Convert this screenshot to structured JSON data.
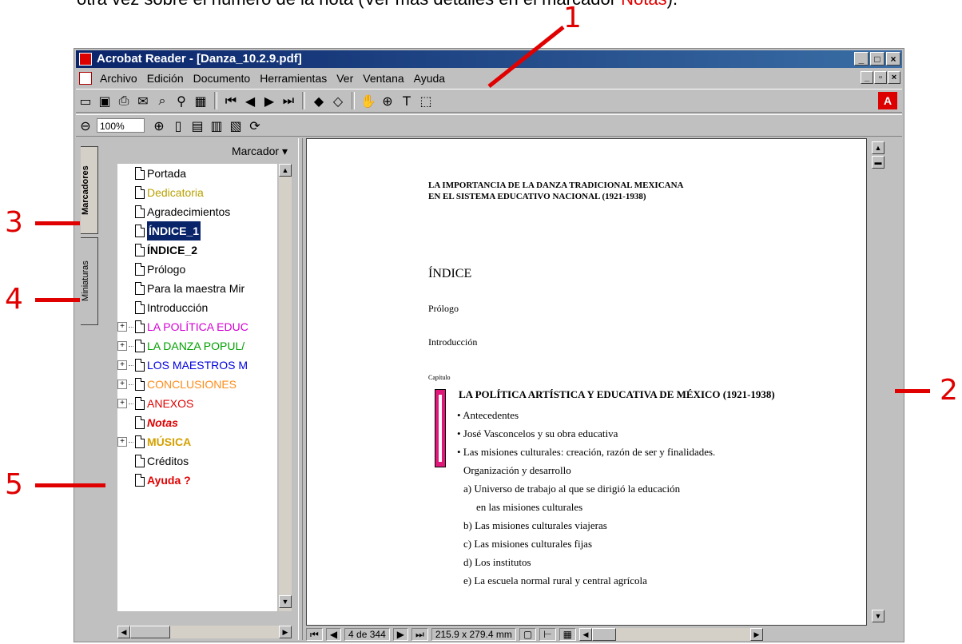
{
  "caption": {
    "text": "otra vez sobre el número de la nota (Ver más detalles en el marcador",
    "highlight": "Notas",
    "tail": ")."
  },
  "callouts": [
    "1",
    "2",
    "3",
    "4",
    "5"
  ],
  "window": {
    "title": "Acrobat Reader - [Danza_10.2.9.pdf]",
    "menu": [
      "Archivo",
      "Edición",
      "Documento",
      "Herramientas",
      "Ver",
      "Ventana",
      "Ayuda"
    ],
    "zoom": "100%"
  },
  "nav": {
    "tabs": [
      "Marcadores",
      "Miniaturas"
    ],
    "menu_label": "Marcador ▾",
    "bookmarks": [
      {
        "label": "Portada",
        "color": "#000000",
        "bold": false,
        "expand": false
      },
      {
        "label": "Dedicatoria",
        "color": "#b8a000",
        "bold": false,
        "expand": false
      },
      {
        "label": "Agradecimientos",
        "color": "#000000",
        "bold": false,
        "expand": false
      },
      {
        "label": "ÍNDICE_1",
        "color": "#ffffff",
        "bold": true,
        "expand": false,
        "selected": true
      },
      {
        "label": "ÍNDICE_2",
        "color": "#000000",
        "bold": true,
        "expand": false
      },
      {
        "label": "Prólogo",
        "color": "#000000",
        "bold": false,
        "expand": false
      },
      {
        "label": "Para la maestra Mir",
        "color": "#000000",
        "bold": false,
        "expand": false
      },
      {
        "label": "Introducción",
        "color": "#000000",
        "bold": false,
        "expand": false
      },
      {
        "label": "LA POLÍTICA EDUC",
        "color": "#d400d4",
        "bold": false,
        "expand": true
      },
      {
        "label": "LA DANZA POPUL/",
        "color": "#00a000",
        "bold": false,
        "expand": true
      },
      {
        "label": "LOS MAESTROS M",
        "color": "#0000e0",
        "bold": false,
        "expand": true
      },
      {
        "label": "CONCLUSIONES",
        "color": "#ff8c1a",
        "bold": false,
        "expand": true
      },
      {
        "label": "ANEXOS",
        "color": "#e00000",
        "bold": false,
        "expand": true
      },
      {
        "label": "Notas",
        "color": "#e00000",
        "bold": true,
        "italic": true,
        "expand": false
      },
      {
        "label": "MÚSICA",
        "color": "#d4a000",
        "bold": true,
        "expand": true
      },
      {
        "label": "Créditos",
        "color": "#000000",
        "bold": false,
        "expand": false
      },
      {
        "label": "Ayuda ?",
        "color": "#e00000",
        "bold": true,
        "expand": false
      }
    ]
  },
  "document": {
    "heading1": "LA IMPORTANCIA DE LA DANZA TRADICIONAL MEXICANA",
    "heading2": "EN EL SISTEMA EDUCATIVO NACIONAL (1921-1938)",
    "indice": "ÍNDICE",
    "prologo": "Prólogo",
    "introduccion": "Introducción",
    "capitulo_label": "Capítulo",
    "capitulo_num": "1",
    "capitulo_title": "LA POLÍTICA ARTÍSTICA Y EDUCATIVA DE MÉXICO (1921-1938)",
    "items": [
      "• Antecedentes",
      "• José Vasconcelos y su obra educativa",
      "• Las misiones culturales: creación, razón de ser y finalidades.",
      "Organización y desarrollo",
      "a) Universo de trabajo al que se dirigió la educación",
      "en las misiones culturales",
      "b) Las misiones culturales viajeras",
      "c) Las misiones culturales fijas",
      "d) Los institutos",
      "e) La escuela normal rural y central agrícola"
    ],
    "accent_color": "#e0187a"
  },
  "status": {
    "page": "4 de 344",
    "size": "215.9 x 279.4 mm"
  }
}
